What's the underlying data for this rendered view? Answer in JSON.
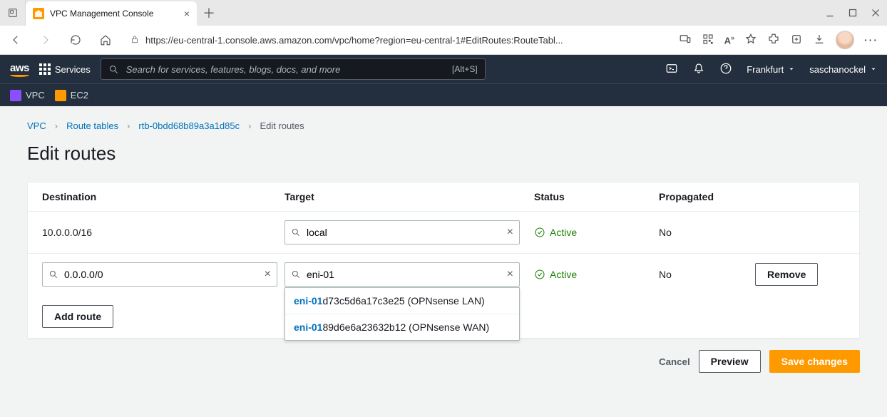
{
  "browser": {
    "tab_title": "VPC Management Console",
    "url": "https://eu-central-1.console.aws.amazon.com/vpc/home?region=eu-central-1#EditRoutes:RouteTabl..."
  },
  "aws_nav": {
    "logo": "aws",
    "services_label": "Services",
    "search_placeholder": "Search for services, features, blogs, docs, and more",
    "search_hint": "[Alt+S]",
    "region": "Frankfurt",
    "user": "saschanockel"
  },
  "subnav": {
    "vpc": "VPC",
    "ec2": "EC2"
  },
  "breadcrumbs": {
    "vpc": "VPC",
    "route_tables": "Route tables",
    "rtb": "rtb-0bdd68b89a3a1d85c",
    "current": "Edit routes"
  },
  "page_title": "Edit routes",
  "table": {
    "head": {
      "destination": "Destination",
      "target": "Target",
      "status": "Status",
      "propagated": "Propagated"
    },
    "row0": {
      "destination": "10.0.0.0/16",
      "target": "local",
      "status": "Active",
      "propagated": "No"
    },
    "row1": {
      "destination": "0.0.0.0/0",
      "target": "eni-01",
      "status": "Active",
      "propagated": "No",
      "remove": "Remove"
    }
  },
  "dropdown": {
    "opt0": {
      "match": "eni-01",
      "rest": "d73c5d6a17c3e25 (OPNsense LAN)"
    },
    "opt1": {
      "match": "eni-01",
      "rest": "89d6e6a23632b12 (OPNsense WAN)"
    }
  },
  "buttons": {
    "add_route": "Add route",
    "cancel": "Cancel",
    "preview": "Preview",
    "save": "Save changes"
  }
}
